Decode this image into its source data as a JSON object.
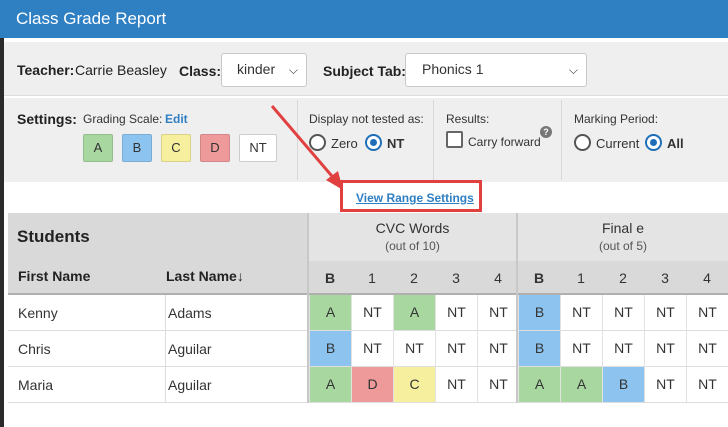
{
  "window": {
    "title": "Class Grade Report"
  },
  "top": {
    "teacher_label": "Teacher:",
    "teacher_name": "Carrie Beasley",
    "class_label": "Class:",
    "class_value": "kinder",
    "subject_label": "Subject Tab:",
    "subject_value": "Phonics 1"
  },
  "settings": {
    "label": "Settings:",
    "grading_scale_label": "Grading Scale:",
    "edit_label": "Edit",
    "scale": [
      {
        "label": "A",
        "color": "#a8d8a0"
      },
      {
        "label": "B",
        "color": "#8cc4ef"
      },
      {
        "label": "C",
        "color": "#f6ef9e"
      },
      {
        "label": "D",
        "color": "#ee9a9a"
      },
      {
        "label": "NT",
        "color": "#ffffff"
      }
    ],
    "display_not_tested_label": "Display not tested as:",
    "display_options": {
      "zero": "Zero",
      "nt": "NT",
      "selected": "NT"
    },
    "results_label": "Results:",
    "carry_forward_label": "Carry forward",
    "carry_forward_checked": false,
    "help_icon": "?",
    "marking_period_label": "Marking Period:",
    "marking_options": {
      "current": "Current",
      "all": "All",
      "selected": "All"
    }
  },
  "range_link": "View Range Settings",
  "table": {
    "students_label": "Students",
    "first_name_header": "First Name",
    "last_name_header": "Last Name",
    "sort_icon": "↓",
    "groups": [
      {
        "name": "CVC Words",
        "subtitle": "(out of 10)",
        "columns": [
          "B",
          "1",
          "2",
          "3",
          "4"
        ]
      },
      {
        "name": "Final e",
        "subtitle": "(out of 5)",
        "columns": [
          "B",
          "1",
          "2",
          "3",
          "4"
        ]
      }
    ],
    "rows": [
      {
        "first": "Kenny",
        "last": "Adams",
        "grades": [
          "A",
          "NT",
          "A",
          "NT",
          "NT",
          "B",
          "NT",
          "NT",
          "NT",
          "NT"
        ]
      },
      {
        "first": "Chris",
        "last": "Aguilar",
        "grades": [
          "B",
          "NT",
          "NT",
          "NT",
          "NT",
          "B",
          "NT",
          "NT",
          "NT",
          "NT"
        ]
      },
      {
        "first": "Maria",
        "last": "Aguilar",
        "grades": [
          "A",
          "D",
          "C",
          "NT",
          "NT",
          "A",
          "A",
          "B",
          "NT",
          "NT"
        ]
      }
    ]
  },
  "colors": {
    "header_blue": "#2f7fc3",
    "annotation_red": "#e04040"
  }
}
